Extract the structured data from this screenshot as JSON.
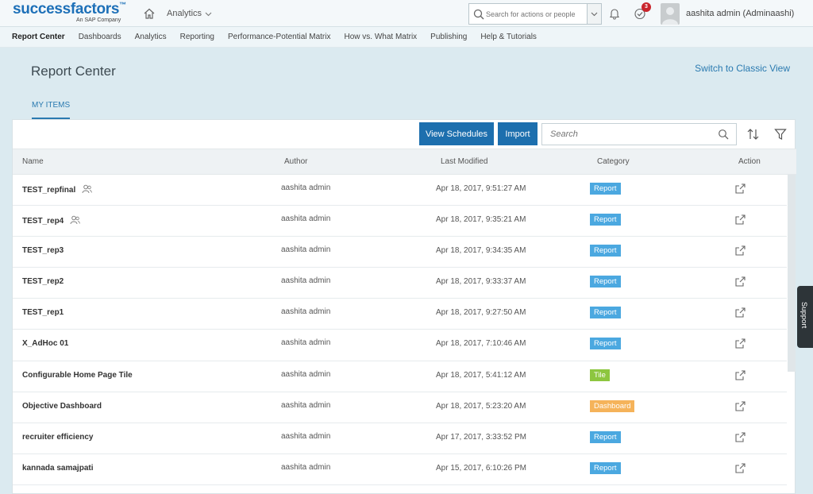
{
  "shell": {
    "logo_text": "successfactors",
    "logo_tm": "™",
    "logo_sub": "An SAP Company",
    "module": "Analytics",
    "search_placeholder": "Search for actions or people",
    "todo_count": "3",
    "user_name": "aashita admin (Adminaashi)"
  },
  "nav": {
    "items": [
      {
        "label": "Report Center"
      },
      {
        "label": "Dashboards"
      },
      {
        "label": "Analytics"
      },
      {
        "label": "Reporting"
      },
      {
        "label": "Performance-Potential Matrix"
      },
      {
        "label": "How vs. What Matrix"
      },
      {
        "label": "Publishing"
      },
      {
        "label": "Help & Tutorials"
      }
    ]
  },
  "page": {
    "title": "Report Center",
    "classic_link": "Switch to Classic View",
    "tab": "MY ITEMS"
  },
  "toolbar": {
    "schedules_label": "View Schedules",
    "import_label": "Import",
    "search_placeholder": "Search"
  },
  "table": {
    "headers": {
      "name": "Name",
      "author": "Author",
      "modified": "Last Modified",
      "category": "Category",
      "action": "Action"
    },
    "rows": [
      {
        "name": "TEST_repfinal",
        "shared": true,
        "author": "aashita admin",
        "modified": "Apr 18, 2017, 9:51:27 AM",
        "category": "Report"
      },
      {
        "name": "TEST_rep4",
        "shared": true,
        "author": "aashita admin",
        "modified": "Apr 18, 2017, 9:35:21 AM",
        "category": "Report"
      },
      {
        "name": "TEST_rep3",
        "shared": false,
        "author": "aashita admin",
        "modified": "Apr 18, 2017, 9:34:35 AM",
        "category": "Report"
      },
      {
        "name": "TEST_rep2",
        "shared": false,
        "author": "aashita admin",
        "modified": "Apr 18, 2017, 9:33:37 AM",
        "category": "Report"
      },
      {
        "name": "TEST_rep1",
        "shared": false,
        "author": "aashita admin",
        "modified": "Apr 18, 2017, 9:27:50 AM",
        "category": "Report"
      },
      {
        "name": "X_AdHoc 01",
        "shared": false,
        "author": "aashita admin",
        "modified": "Apr 18, 2017, 7:10:46 AM",
        "category": "Report"
      },
      {
        "name": "Configurable Home Page Tile",
        "shared": false,
        "author": "aashita admin",
        "modified": "Apr 18, 2017, 5:41:12 AM",
        "category": "Tile"
      },
      {
        "name": "Objective Dashboard",
        "shared": false,
        "author": "aashita admin",
        "modified": "Apr 18, 2017, 5:23:20 AM",
        "category": "Dashboard"
      },
      {
        "name": "recruiter efficiency",
        "shared": false,
        "author": "aashita admin",
        "modified": "Apr 17, 2017, 3:33:52 PM",
        "category": "Report"
      },
      {
        "name": "kannada samajpati",
        "shared": false,
        "author": "aashita admin",
        "modified": "Apr 15, 2017, 6:10:26 PM",
        "category": "Report"
      }
    ]
  },
  "category_colors": {
    "Report": "#4ba8e0",
    "Tile": "#8dc63f",
    "Dashboard": "#f5b35a"
  },
  "support_label": "Support"
}
